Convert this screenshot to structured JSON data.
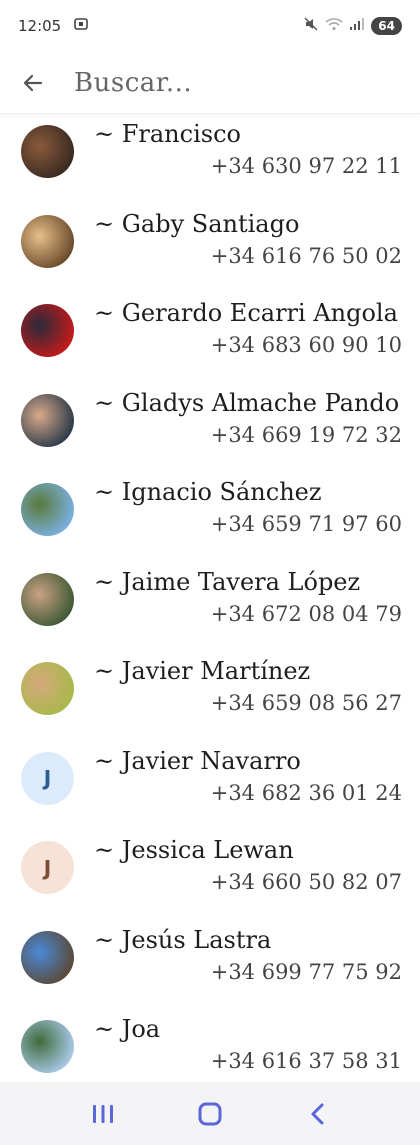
{
  "status_bar": {
    "time": "12:05",
    "battery": "64"
  },
  "search": {
    "placeholder": "Buscar..."
  },
  "contacts": [
    {
      "name": "~ Francisco",
      "phone": "+34 630 97 22 11",
      "avatar_type": "photo",
      "avatar_colors": [
        "#3a2a22",
        "#8b5a3c"
      ]
    },
    {
      "name": "~ Gaby Santiago",
      "phone": "+34 616 76 50 02",
      "avatar_type": "photo",
      "avatar_colors": [
        "#6b4b2b",
        "#e6c08a"
      ]
    },
    {
      "name": "~ Gerardo Ecarri Angola",
      "phone": "+34 683 60 90 10",
      "avatar_type": "photo",
      "avatar_colors": [
        "#c21b1b",
        "#2a2a3a"
      ]
    },
    {
      "name": "~ Gladys Almache Pando",
      "phone": "+34 669 19 72 32",
      "avatar_type": "photo",
      "avatar_colors": [
        "#2c3b4a",
        "#d8a98a"
      ]
    },
    {
      "name": "~ Ignacio Sánchez",
      "phone": "+34 659 71 97 60",
      "avatar_type": "photo",
      "avatar_colors": [
        "#7ab0e0",
        "#5a7a3a"
      ]
    },
    {
      "name": "~ Jaime Tavera López",
      "phone": "+34 672 08 04 79",
      "avatar_type": "photo",
      "avatar_colors": [
        "#3f5a35",
        "#c9a184"
      ]
    },
    {
      "name": "~ Javier Martínez",
      "phone": "+34 659 08 56 27",
      "avatar_type": "photo",
      "avatar_colors": [
        "#a8b84a",
        "#d6a97c"
      ]
    },
    {
      "name": "~ Javier Navarro",
      "phone": "+34 682 36 01 24",
      "avatar_type": "letter",
      "avatar_letter": "J",
      "avatar_bg": "#dcebfb",
      "avatar_fg": "#2c5d8f"
    },
    {
      "name": "~ Jessica Lewan",
      "phone": "+34 660 50 82 07",
      "avatar_type": "letter",
      "avatar_letter": "J",
      "avatar_bg": "#f6e2d6",
      "avatar_fg": "#7a4e37"
    },
    {
      "name": "~ Jesús Lastra",
      "phone": "+34 699 77 75 92",
      "avatar_type": "photo",
      "avatar_colors": [
        "#5a4a3a",
        "#4a8ad8"
      ]
    },
    {
      "name": "~ Joa",
      "phone": "+34 616 37 58 31",
      "avatar_type": "photo",
      "avatar_colors": [
        "#a9c8e6",
        "#3f6a3a"
      ]
    }
  ],
  "nav": {
    "recents": "recents-icon",
    "home": "home-icon",
    "back": "back-icon"
  },
  "colors": {
    "nav_icon": "#5a67d8",
    "back_arrow": "#555555"
  }
}
